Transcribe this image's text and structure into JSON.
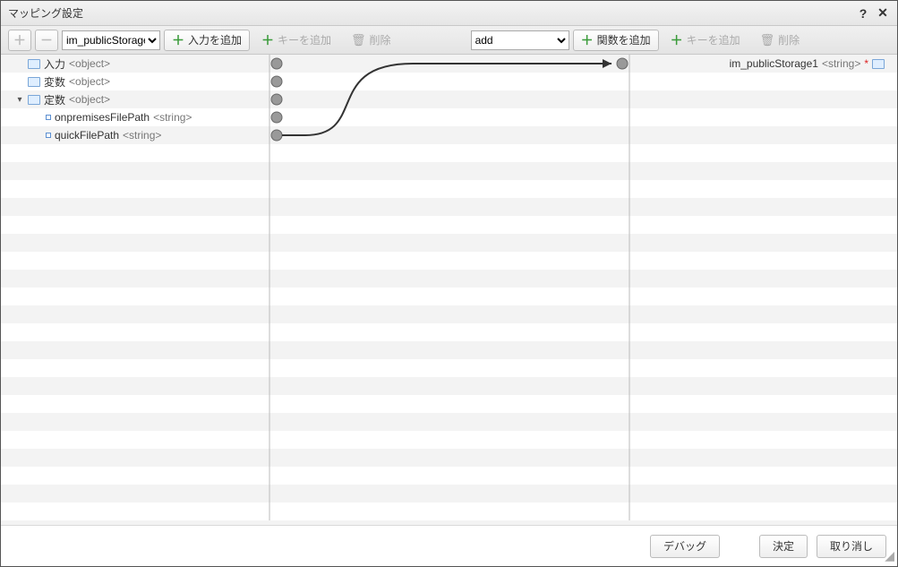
{
  "title": "マッピング設定",
  "toolbar_left": {
    "plus": "＋",
    "minus": "－",
    "select_value": "im_publicStorage",
    "add_input": "入力を追加",
    "add_key": "キーを追加",
    "delete": "削除"
  },
  "toolbar_right": {
    "select_value": "add",
    "add_func": "関数を追加",
    "add_key": "キーを追加",
    "delete": "削除"
  },
  "tree_left": [
    {
      "label": "入力",
      "type": "<object>",
      "icon": "folder",
      "indent": 0,
      "toggle": ""
    },
    {
      "label": "変数",
      "type": "<object>",
      "icon": "folder",
      "indent": 0,
      "toggle": ""
    },
    {
      "label": "定数",
      "type": "<object>",
      "icon": "folder",
      "indent": 0,
      "toggle": "▾"
    },
    {
      "label": "onpremisesFilePath",
      "type": "<string>",
      "icon": "bullet",
      "indent": 1,
      "toggle": ""
    },
    {
      "label": "quickFilePath",
      "type": "<string>",
      "icon": "bullet",
      "indent": 1,
      "toggle": ""
    }
  ],
  "output": {
    "label": "im_publicStorage1",
    "type": "<string>"
  },
  "footer": {
    "debug": "デバッグ",
    "ok": "決定",
    "cancel": "取り消し"
  }
}
